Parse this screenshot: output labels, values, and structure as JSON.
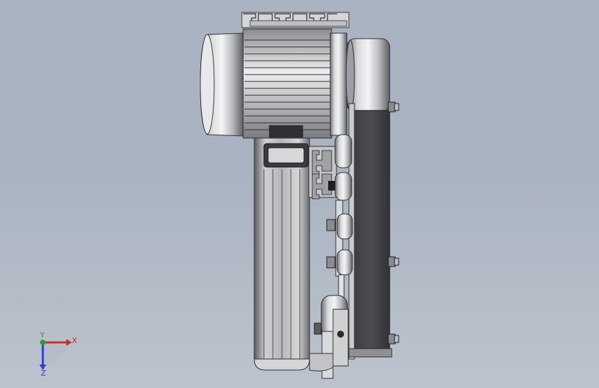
{
  "triad": {
    "x_label": "X",
    "y_label": "Y",
    "z_label": "Z",
    "x_color": "#d22a2a",
    "y_color": "#2aa02a",
    "z_color": "#2a3fcf"
  },
  "model": {
    "components": [
      "top-rail-profile",
      "electric-motor",
      "motor-pulley-guard",
      "belt-housing",
      "vertical-column",
      "extrusion-profile",
      "connecting-rod",
      "bottom-clamp",
      "base-bracket",
      "hex-bolts"
    ]
  }
}
